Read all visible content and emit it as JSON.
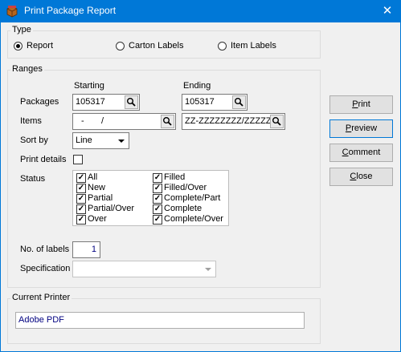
{
  "window": {
    "title": "Print Package Report",
    "close_glyph": "✕"
  },
  "type_group": {
    "label": "Type",
    "options": [
      {
        "label": "Report",
        "selected": true
      },
      {
        "label": "Carton Labels",
        "selected": false
      },
      {
        "label": "Item Labels",
        "selected": false
      }
    ]
  },
  "ranges_group": {
    "label": "Ranges",
    "starting_header": "Starting",
    "ending_header": "Ending",
    "packages": {
      "label": "Packages",
      "start": "105317",
      "end": "105317"
    },
    "items": {
      "label": "Items",
      "start": "-       /",
      "end": "ZZ-ZZZZZZZZ/ZZZZZZZ"
    },
    "sort_by": {
      "label": "Sort by",
      "value": "Line"
    },
    "print_details": {
      "label": "Print details",
      "checked": false
    },
    "status": {
      "label": "Status",
      "left": [
        {
          "label": "All",
          "checked": true
        },
        {
          "label": "New",
          "checked": true
        },
        {
          "label": "Partial",
          "checked": true
        },
        {
          "label": "Partial/Over",
          "checked": true
        },
        {
          "label": "Over",
          "checked": true
        }
      ],
      "right": [
        {
          "label": "Filled",
          "checked": true
        },
        {
          "label": "Filled/Over",
          "checked": true
        },
        {
          "label": "Complete/Part",
          "checked": true
        },
        {
          "label": "Complete",
          "checked": true
        },
        {
          "label": "Complete/Over",
          "checked": true
        }
      ]
    },
    "no_of_labels": {
      "label": "No. of labels",
      "value": "1"
    },
    "specification": {
      "label": "Specification",
      "value": ""
    }
  },
  "printer_group": {
    "label": "Current Printer",
    "value": "Adobe PDF"
  },
  "buttons": {
    "print": {
      "first": "P",
      "rest": "rint"
    },
    "preview": {
      "first": "P",
      "rest": "review"
    },
    "comment": {
      "first": "C",
      "rest": "omment"
    },
    "close": {
      "first": "C",
      "rest": "lose"
    }
  },
  "colors": {
    "titlebar": "#0078d7",
    "printer_text": "#000080",
    "disabled_arrow": "#a0a0a0"
  }
}
